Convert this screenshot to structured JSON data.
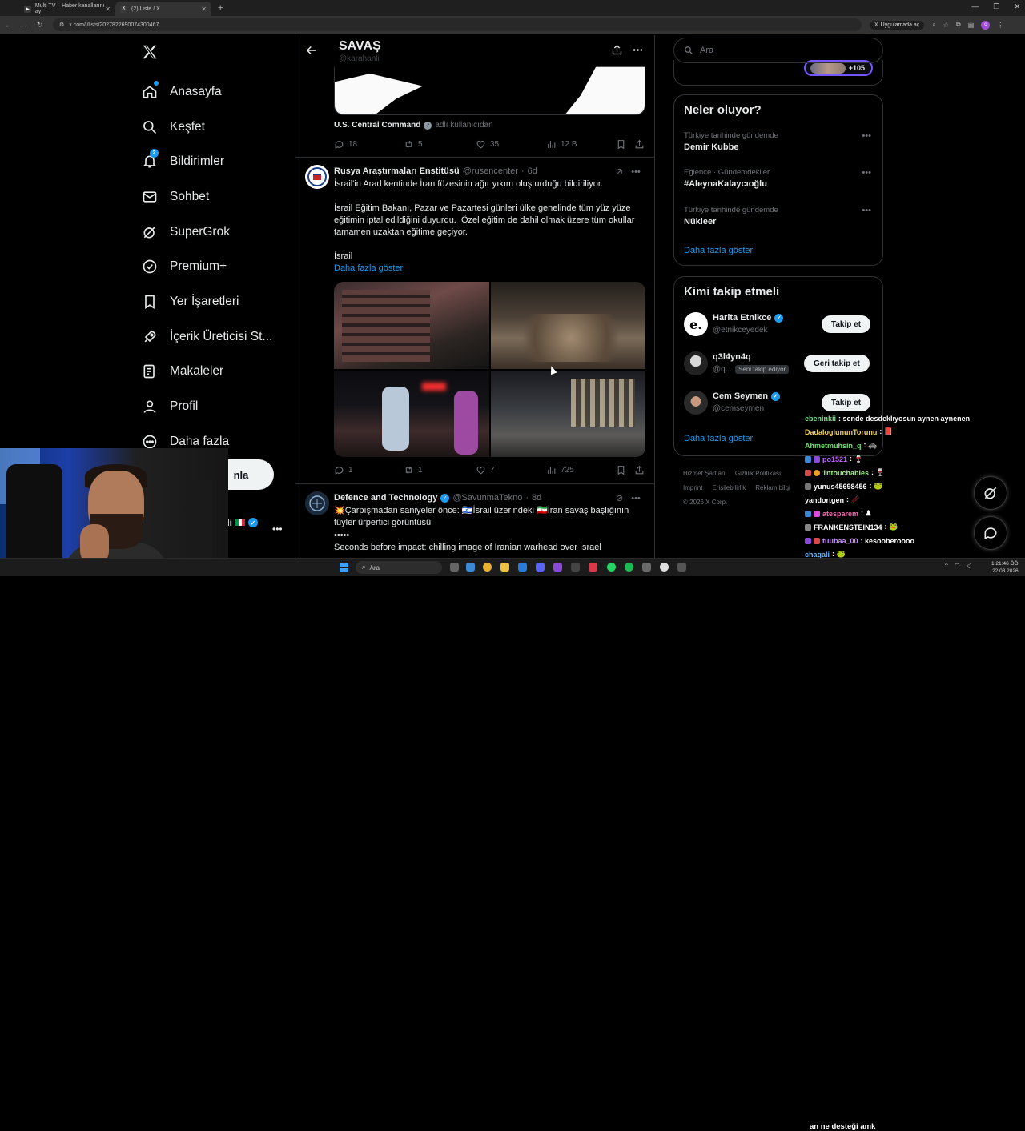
{
  "browser": {
    "tabs": [
      {
        "title": "Multi TV – Haber kanallarını ay",
        "active": false
      },
      {
        "title": "(2) Liste / X",
        "active": true
      }
    ],
    "url": "x.com/i/lists/2027822690074300467",
    "app_badge": "Uygulamada aç",
    "profile_initial": "c"
  },
  "sidebar": {
    "items": [
      {
        "label": "Anasayfa",
        "icon": "home-icon"
      },
      {
        "label": "Keşfet",
        "icon": "search-icon"
      },
      {
        "label": "Bildirimler",
        "icon": "bell-icon",
        "badge": "2"
      },
      {
        "label": "Sohbet",
        "icon": "mail-icon"
      },
      {
        "label": "SuperGrok",
        "icon": "grok-icon"
      },
      {
        "label": "Premium+",
        "icon": "premium-icon"
      },
      {
        "label": "Yer İşaretleri",
        "icon": "bookmark-icon"
      },
      {
        "label": "İçerik Üreticisi St...",
        "icon": "rocket-icon"
      },
      {
        "label": "Makaleler",
        "icon": "article-icon"
      },
      {
        "label": "Profil",
        "icon": "person-icon"
      },
      {
        "label": "Daha fazla",
        "icon": "more-circle-icon"
      }
    ],
    "post_button_partial": "nla",
    "account_partial": "nli"
  },
  "list_header": {
    "title": "SAVAŞ",
    "subtitle": "@karahanli"
  },
  "top_tweet": {
    "source_name": "U.S. Central Command",
    "source_suffix": "adlı kullanıcıdan",
    "replies": "18",
    "reposts": "5",
    "likes": "35",
    "views": "12 B"
  },
  "tweet1": {
    "name": "Rusya Araştırmaları Enstitüsü",
    "handle": "@rusencenter",
    "time": "6d",
    "text": "İsrail'in Arad kentinde İran füzesinin ağır yıkım oluşturduğu bildiriliyor.\n\nİsrail Eğitim Bakanı, Pazar ve Pazartesi günleri ülke genelinde tüm yüz yüze eğitimin iptal edildiğini duyurdu.  Özel eğitim de dahil olmak üzere tüm okullar tamamen uzaktan eğitime geçiyor.\n\nİsrail",
    "show_more": "Daha fazla göster",
    "replies": "1",
    "reposts": "1",
    "likes": "7",
    "views": "725"
  },
  "tweet2": {
    "name": "Defence and Technology",
    "handle": "@SavunmaTekno",
    "time": "8d",
    "line1": "💥Çarpışmadan saniyeler önce: 🇮🇱İsrail üzerindeki 🇮🇷İran savaş başlığının tüyler ürpertici görüntüsü",
    "line2": "•••••",
    "line3": "Seconds before impact: chilling image of Iranian warhead over Israel"
  },
  "right": {
    "search_placeholder": "Ara",
    "space_count": "+105",
    "trends_title": "Neler oluyor?",
    "trends": [
      {
        "context": "Türkiye tarihinde gündemde",
        "title": "Demir Kubbe"
      },
      {
        "context": "Eğlence · Gündemdekiler",
        "title": "#AleynaKalaycıoğlu"
      },
      {
        "context": "Türkiye tarihinde gündemde",
        "title": "Nükleer"
      }
    ],
    "trends_more": "Daha fazla göster",
    "who_title": "Kimi takip etmeli",
    "who": [
      {
        "name": "Harita Etnikce",
        "handle": "@etnikceyedek",
        "button": "Takip et",
        "verified": true,
        "follows_you": ""
      },
      {
        "name": "q3l4yn4q",
        "handle": "@q...",
        "button": "Geri takip et",
        "verified": false,
        "follows_you": "Seni takip ediyor"
      },
      {
        "name": "Cem Seymen",
        "handle": "@cemseymen",
        "button": "Takip et",
        "verified": true,
        "follows_you": ""
      }
    ],
    "who_more": "Daha fazla göster",
    "footer": [
      "Hizmet Şartları",
      "Gizlilik Politikası",
      "Imprint",
      "Erişilebilirlik",
      "Reklam bilgi",
      "© 2026 X Corp."
    ]
  },
  "chat": {
    "messages": [
      {
        "user": "ebeninkii",
        "text": ": sende desdeklıyosun aynen aynenen",
        "color": "#7fe08a"
      },
      {
        "user": "DadaloglununTorunu",
        "text": ": 📕",
        "color": "#f2d35a"
      },
      {
        "user": "Ahmetmuhsin_q",
        "text": ": 🚓",
        "color": "#6fe06f"
      },
      {
        "user": "po1521",
        "text": ": 🍷",
        "color": "#c264ff"
      },
      {
        "user": "1ntouchables",
        "text": ": 🍷",
        "color": "#a5f08a"
      },
      {
        "user": "yunus45698456",
        "text": ": 🐸",
        "color": "#ffffff"
      },
      {
        "user": "yandortgen",
        "text": ": 🥢",
        "color": "#ffffff"
      },
      {
        "user": "atesparem",
        "text": ": ♟",
        "color": "#f06ab0"
      },
      {
        "user": "FRANKENSTEIN134",
        "text": ": 🐸",
        "color": "#ffffff"
      },
      {
        "user": "tuubaa_00",
        "text": ": kesooberoooo",
        "color": "#c98bff"
      },
      {
        "user": "chagali",
        "text": ": 🐸",
        "color": "#6ab8ff"
      }
    ],
    "last_line": "an ne desteği amk"
  },
  "taskbar": {
    "search_label": "Ara",
    "time": "1:21:46 ÖÖ",
    "date": "22.03.2026"
  },
  "colors": {
    "accent": "#1d9bf0",
    "background": "#000000",
    "border": "#2f3336"
  }
}
